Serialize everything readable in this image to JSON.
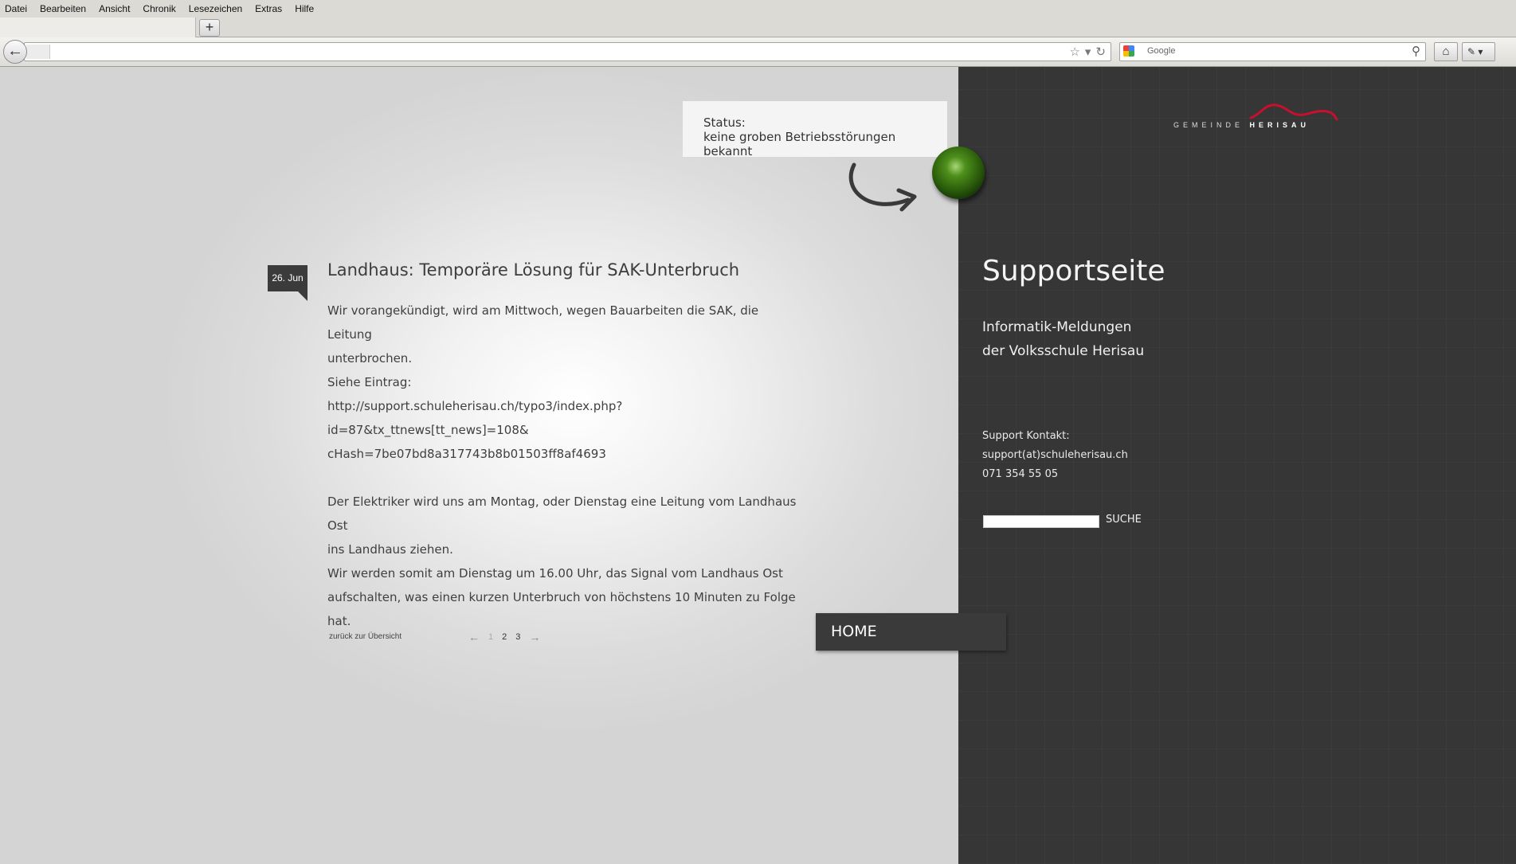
{
  "browser": {
    "menu": [
      "Datei",
      "Bearbeiten",
      "Ansicht",
      "Chronik",
      "Lesezeichen",
      "Extras",
      "Hilfe"
    ],
    "newtab_label": "+",
    "url": "",
    "search_placeholder": "Google"
  },
  "status": {
    "label": "Status:",
    "text": "keine groben Betriebsstörungen bekannt",
    "light_color": "#3b7a13"
  },
  "article": {
    "date": "26. Jun",
    "title": "Landhaus: Temporäre Lösung für SAK-Unterbruch",
    "paragraphs": [
      "Wir vorangekündigt, wird am Mittwoch, wegen Bauarbeiten die SAK, die Leitung",
      "unterbrochen.",
      "Siehe Eintrag:",
      "http://support.schuleherisau.ch/typo3/index.php?id=87&tx_ttnews[tt_news]=108&",
      "cHash=7be07bd8a317743b8b01503ff8af4693",
      "Der Elektriker wird uns am Montag, oder Dienstag eine Leitung vom Landhaus Ost",
      "ins Landhaus ziehen.",
      "Wir werden somit am Dienstag um 16.00 Uhr, das Signal vom Landhaus Ost",
      "aufschalten, was einen kurzen Unterbruch von höchstens 10 Minuten zu Folge hat."
    ],
    "back_link": "zurück zur Übersicht",
    "pager": {
      "prev": "←",
      "pages": [
        "1",
        "2",
        "3"
      ],
      "current": "1",
      "next": "→"
    }
  },
  "nav": {
    "home": "HOME"
  },
  "sidebar": {
    "logo_prefix": "GEMEINDE",
    "logo_name": "HERISAU",
    "title": "Supportseite",
    "subtitle_line1": "Informatik-Meldungen",
    "subtitle_line2": "der Volksschule Herisau",
    "contact_label": "Support Kontakt:",
    "contact_email": "support(at)schuleherisau.ch",
    "contact_phone": "071 354 55 05",
    "search_button": "SUCHE",
    "search_value": ""
  },
  "colors": {
    "sidebar_bg": "#363636",
    "accent_red": "#c8102e",
    "status_green": "#3b7a13"
  }
}
